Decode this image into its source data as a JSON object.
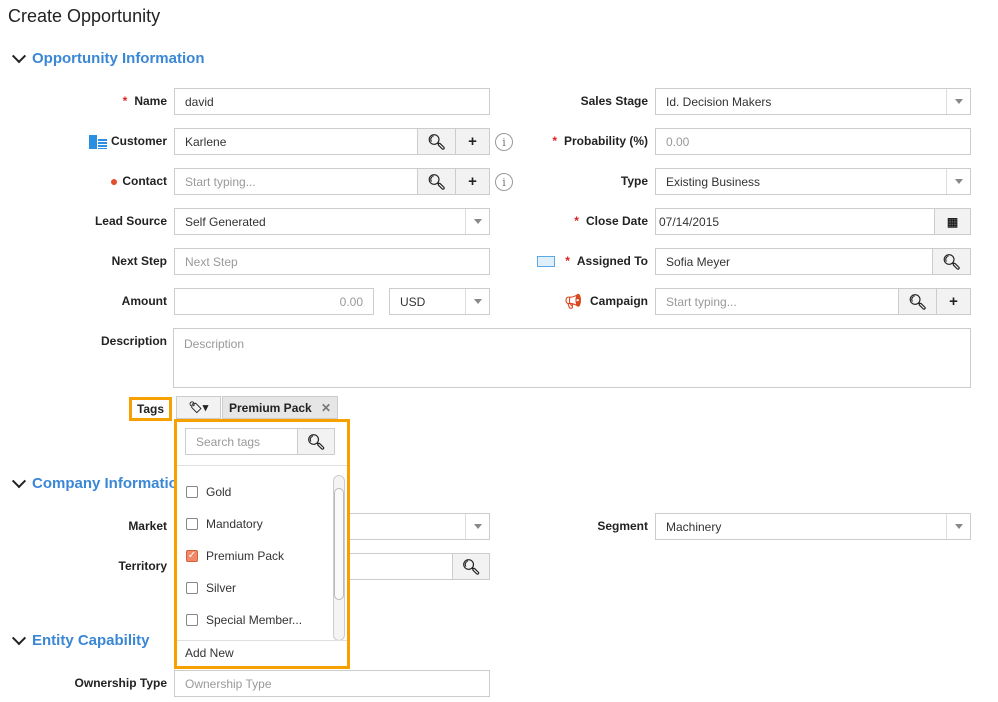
{
  "title": "Create Opportunity",
  "sections": {
    "opportunity": "Opportunity Information",
    "company": "Company Information",
    "entity": "Entity Capability"
  },
  "left": {
    "name": {
      "label": "Name",
      "value": "david"
    },
    "customer": {
      "label": "Customer",
      "value": "Karlene"
    },
    "contact": {
      "label": "Contact",
      "placeholder": "Start typing..."
    },
    "lead_source": {
      "label": "Lead Source",
      "value": "Self Generated"
    },
    "next_step": {
      "label": "Next Step",
      "placeholder": "Next Step"
    },
    "amount": {
      "label": "Amount",
      "value": "0.00",
      "currency": "USD"
    },
    "description": {
      "label": "Description",
      "placeholder": "Description"
    },
    "tags": {
      "label": "Tags",
      "selected": "Premium Pack"
    }
  },
  "right": {
    "sales_stage": {
      "label": "Sales Stage",
      "value": "Id. Decision Makers"
    },
    "probability": {
      "label": "Probability (%)",
      "value": "0.00"
    },
    "type": {
      "label": "Type",
      "value": "Existing Business"
    },
    "close_date": {
      "label": "Close Date",
      "value": "07/14/2015"
    },
    "assigned_to": {
      "label": "Assigned To",
      "value": "Sofia Meyer"
    },
    "campaign": {
      "label": "Campaign",
      "placeholder": "Start typing..."
    }
  },
  "company": {
    "market": {
      "label": "Market"
    },
    "territory": {
      "label": "Territory"
    },
    "segment": {
      "label": "Segment",
      "value": "Machinery"
    }
  },
  "entity": {
    "ownership_type": {
      "label": "Ownership Type",
      "placeholder": "Ownership Type"
    }
  },
  "tag_dropdown": {
    "search_placeholder": "Search tags",
    "items": [
      {
        "label": "Gold",
        "checked": false
      },
      {
        "label": "Mandatory",
        "checked": false
      },
      {
        "label": "Premium Pack",
        "checked": true
      },
      {
        "label": "Silver",
        "checked": false
      },
      {
        "label": "Special Member...",
        "checked": false
      }
    ],
    "add_new": "Add New"
  },
  "colors": {
    "accent": "#3a87d6",
    "highlight": "#f7a000",
    "required": "#e02020"
  }
}
